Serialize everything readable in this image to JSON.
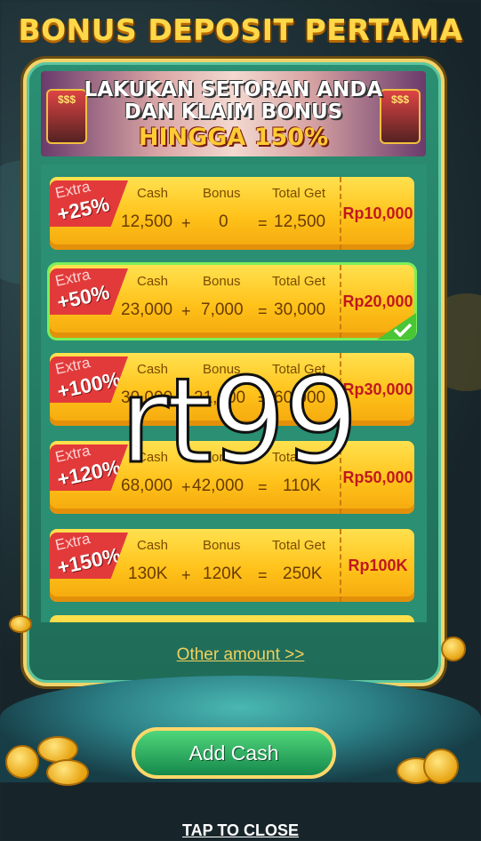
{
  "title": "BONUS DEPOSIT PERTAMA",
  "banner": {
    "line1": "LAKUKAN SETORAN ANDA",
    "line2": "DAN KLAIM BONUS",
    "line3": "HINGGA 150%"
  },
  "columns": {
    "cash": "Cash",
    "bonus": "Bonus",
    "total": "Total Get"
  },
  "offers": [
    {
      "extra": "Extra",
      "percent": "+25%",
      "cash": "12,500",
      "bonus": "0",
      "total": "12,500",
      "price": "Rp10,000",
      "selected": false
    },
    {
      "extra": "Extra",
      "percent": "+50%",
      "cash": "23,000",
      "bonus": "7,000",
      "total": "30,000",
      "price": "Rp20,000",
      "selected": true
    },
    {
      "extra": "Extra",
      "percent": "+100%",
      "cash": "39,000",
      "bonus": "21,000",
      "total": "60,000",
      "price": "Rp30,000",
      "selected": false
    },
    {
      "extra": "Extra",
      "percent": "+120%",
      "cash": "68,000",
      "bonus": "42,000",
      "total": "110K",
      "price": "Rp50,000",
      "selected": false
    },
    {
      "extra": "Extra",
      "percent": "+150%",
      "cash": "130K",
      "bonus": "120K",
      "total": "250K",
      "price": "Rp100K",
      "selected": false
    }
  ],
  "operators": {
    "plus": "+",
    "equals": "="
  },
  "other_amount": "Other amount >>",
  "add_cash": "Add Cash",
  "tap_to_close": "TAP TO CLOSE",
  "watermark": "rt99",
  "shop_sign": "$$$",
  "colors": {
    "accent_gold": "#ffd84a",
    "card": "#ffc21a",
    "price": "#c0181f",
    "selected": "#7cf05a",
    "button": "#16894c"
  }
}
